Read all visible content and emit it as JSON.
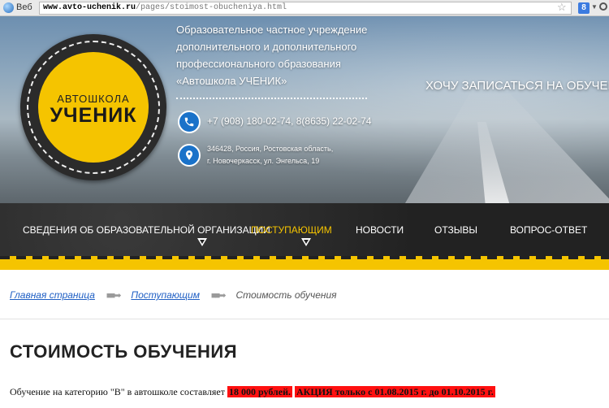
{
  "browser": {
    "label": "Веб",
    "url_domain": "www.avto-uchenik.ru",
    "url_path": "/pages/stoimost-obucheniya.html",
    "star": "☆",
    "search_engine": "8",
    "dropdown": "▼"
  },
  "header": {
    "logo_small": "АВТОШКОЛА",
    "logo_big": "УЧЕНИК",
    "org_lines": [
      "Образовательное частное учреждение",
      "дополнительного и дополнительного",
      "профессионального образования",
      "«Автошкола УЧЕНИК»"
    ],
    "phone": "+7 (908) 180-02-74, 8(8635) 22-02-74",
    "address_line1": "346428, Россия, Ростовская область,",
    "address_line2": "г. Новочеркасск, ул. Энгельса, 19",
    "cta": "ХОЧУ ЗАПИСАТЬСЯ НА ОБУЧЕНИЕ!",
    "icon_color": "#1a72c9",
    "logo_color": "#f5c400"
  },
  "nav": {
    "items": [
      {
        "label": "СВЕДЕНИЯ ОБ ОБРАЗОВАТЕЛЬНОЙ ОРГАНИЗАЦИИ",
        "has_dropdown": true,
        "active": false
      },
      {
        "label": "ПОСТУПАЮЩИМ",
        "has_dropdown": true,
        "active": true
      },
      {
        "label": "НОВОСТИ",
        "has_dropdown": false,
        "active": false
      },
      {
        "label": "ОТЗЫВЫ",
        "has_dropdown": false,
        "active": false
      },
      {
        "label": "ВОПРОС-ОТВЕТ",
        "has_dropdown": false,
        "active": false
      }
    ],
    "active_color": "#f5c400"
  },
  "breadcrumb": {
    "home": "Главная страница",
    "parent": "Поступающим",
    "current": "Стоимость обучения",
    "separator": "■■➡"
  },
  "page": {
    "title": "СТОИМОСТЬ ОБУЧЕНИЯ",
    "price_text": "Обучение на категорию \"B\" в автошколе составляет",
    "price_value": "18 000 рублей.",
    "promo": "АКЦИЯ только с 01.08.2015 г. до 01.10.2015 г.",
    "highlight_color": "#ff1010"
  }
}
